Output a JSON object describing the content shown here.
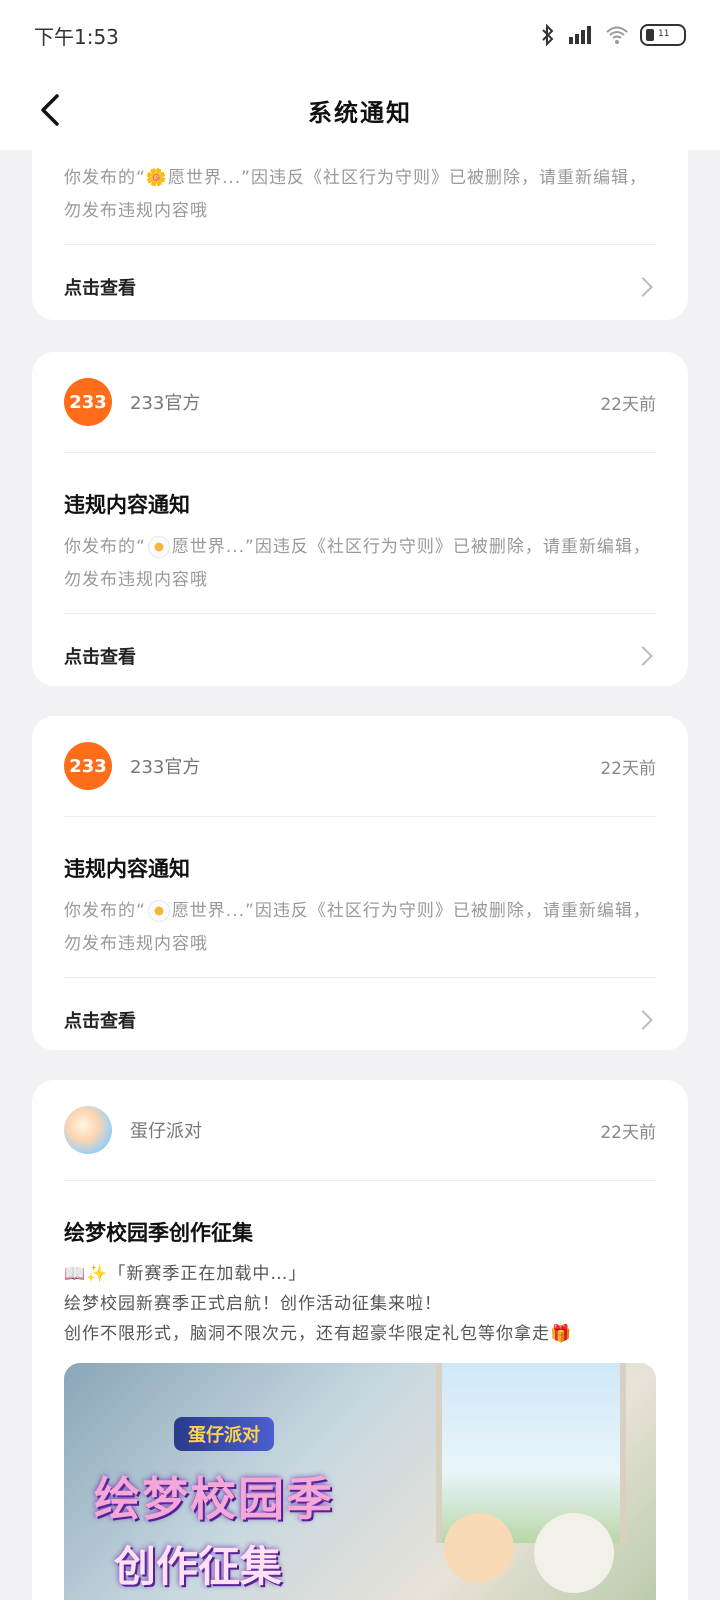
{
  "status_bar": {
    "time": "下午1:53",
    "icons": [
      "bluetooth-icon",
      "signal-icon",
      "wifi-icon",
      "battery-icon"
    ],
    "battery": "11"
  },
  "header": {
    "title": "系统通知"
  },
  "cards": [
    {
      "text": "你发布的“🌼愿世界...”因违反《社区行为守则》已被删除，请重新编辑，勿发布违规内容哦",
      "view": "点击查看"
    },
    {
      "sender": "233官方",
      "time": "22天前",
      "title": "违规内容通知",
      "text_prefix": "你发布的“",
      "text_main": "愿世界...”因违反《社区行为守则》已被删除，请重新编辑，勿发布违规内容哦",
      "view": "点击查看"
    },
    {
      "sender": "233官方",
      "time": "22天前",
      "title": "违规内容通知",
      "text_prefix": "你发布的“",
      "text_main": "愿世界...”因违反《社区行为守则》已被删除，请重新编辑，勿发布违规内容哦",
      "view": "点击查看"
    },
    {
      "sender": "蛋仔派对",
      "time": "22天前",
      "title": "绘梦校园季创作征集",
      "line1": "📖✨「新赛季正在加载中…」",
      "line2": "绘梦校园新赛季正式启航！创作活动征集来啦！",
      "line3": "创作不限形式，脑洞不限次元，还有超豪华限定礼包等你拿走🎁",
      "banner_logo": "蛋仔派对",
      "banner_title": "绘梦校园季",
      "banner_sub": "创作征集"
    }
  ],
  "avatar_label": "233",
  "colors": {
    "background": "#f2f2f4",
    "card": "#ffffff",
    "accent_orange": "#ff6d1a"
  }
}
